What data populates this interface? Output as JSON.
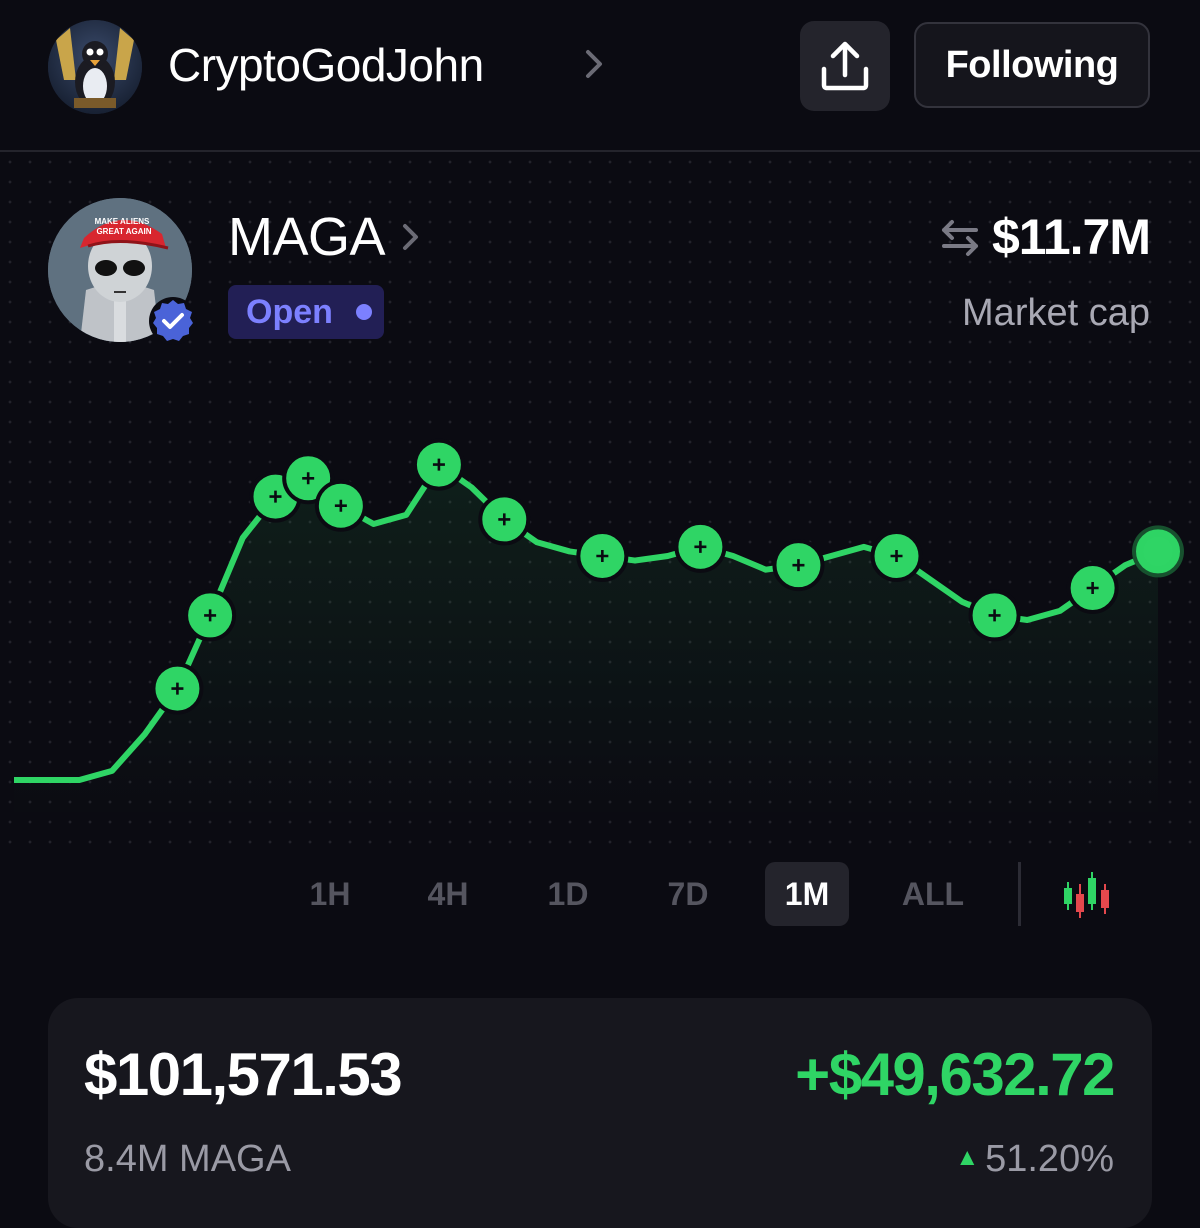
{
  "header": {
    "username": "CryptoGodJohn",
    "following_label": "Following"
  },
  "token": {
    "name": "MAGA",
    "status": "Open",
    "market_cap_value": "$11.7M",
    "market_cap_label": "Market cap",
    "avatar_text": "MAKE ALIENS GREAT AGAIN"
  },
  "time_ranges": [
    "1H",
    "4H",
    "1D",
    "7D",
    "1M",
    "ALL"
  ],
  "selected_range": "1M",
  "position": {
    "value": "$101,571.53",
    "pnl": "+$49,632.72",
    "amount": "8.4M MAGA",
    "pnl_percent": "51.20%"
  },
  "colors": {
    "background": "#0b0b12",
    "accent_green": "#2fd565",
    "status_purple": "#7c80ff",
    "loss_red": "#e5484d"
  },
  "chart_data": {
    "type": "line",
    "title": "",
    "xlabel": "",
    "ylabel": "",
    "note_markers": "buy markers (+) along the line",
    "y": [
      2.0,
      2.0,
      2.0,
      2.2,
      3.0,
      4.0,
      5.6,
      7.3,
      8.2,
      8.6,
      8.0,
      7.6,
      7.8,
      8.9,
      8.4,
      7.7,
      7.2,
      7.0,
      6.9,
      6.8,
      6.9,
      7.1,
      6.9,
      6.6,
      6.7,
      6.9,
      7.1,
      6.9,
      6.4,
      5.9,
      5.6,
      5.5,
      5.7,
      6.2,
      6.7,
      7.0
    ],
    "buy_markers": [
      5,
      6,
      8,
      9,
      10,
      13,
      15,
      18,
      21,
      24,
      27,
      30,
      33,
      35
    ]
  }
}
